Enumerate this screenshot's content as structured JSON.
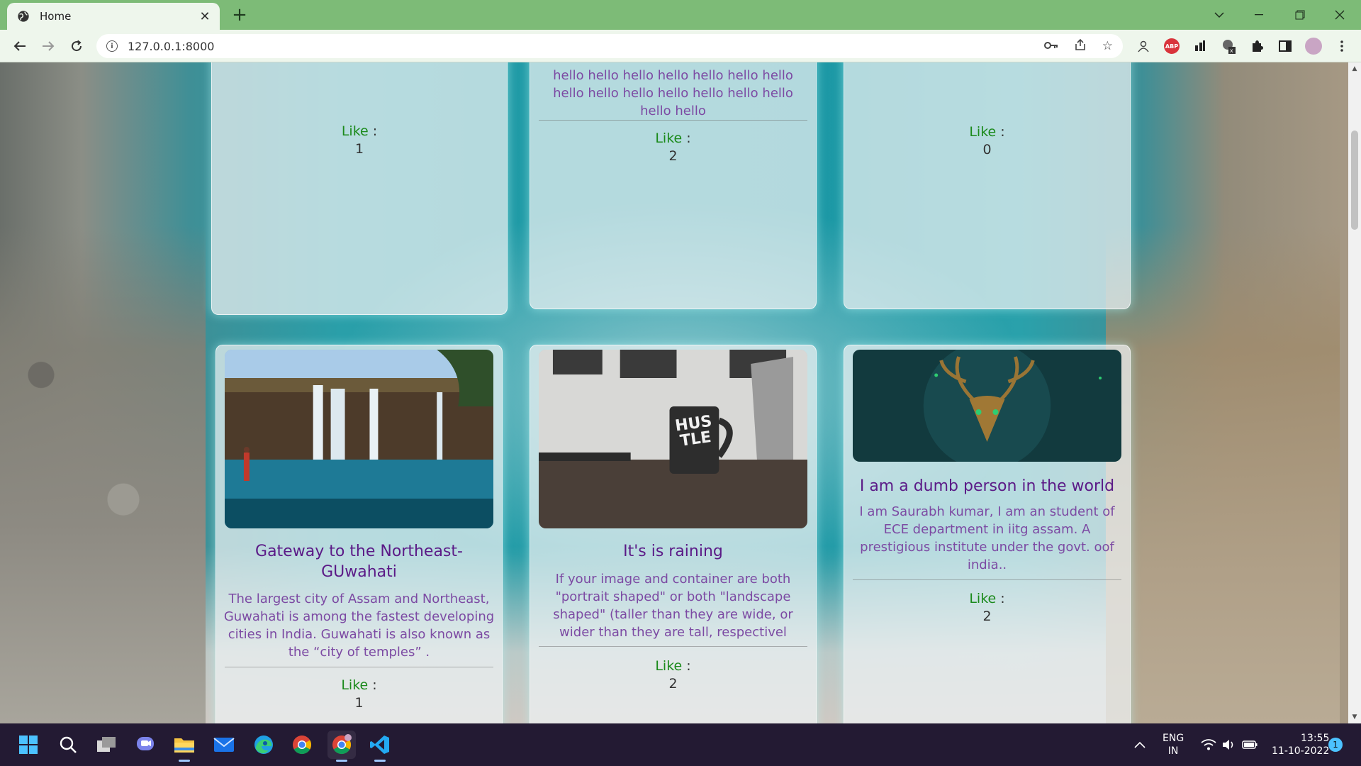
{
  "browser": {
    "tab_title": "Home",
    "url": "127.0.0.1:8000"
  },
  "cards_top": [
    {
      "like_label": "Like",
      "like_count": "1"
    },
    {
      "desc": "hello hello hello hello hello hello hello hello hello hello hello hello hello hello hello hello",
      "like_label": "Like",
      "like_count": "2"
    },
    {
      "like_label": "Like",
      "like_count": "0"
    }
  ],
  "cards_bottom": [
    {
      "title": "Gateway to the Northeast-GUwahati",
      "desc": "The largest city of Assam and Northeast, Guwahati is among the fastest developing cities in India. Guwahati is also known as the “city of temples” .",
      "like_label": "Like",
      "like_count": "1",
      "image": "waterfall-photo"
    },
    {
      "title": "It's is raining",
      "desc": "If your image and container are both \"portrait shaped\" or both \"landscape shaped\" (taller than they are wide, or wider than they are tall, respectivel",
      "like_label": "Like",
      "like_count": "2",
      "image": "mug-photo",
      "mug_text": "HUS TLE"
    },
    {
      "title": "I am a dumb person in the world",
      "desc": "I am Saurabh kumar, I am an student of ECE department in iitg assam. A prestigious institute under the govt. oof india..",
      "like_label": "Like",
      "like_count": "2",
      "image": "deer-photo"
    }
  ],
  "taskbar": {
    "lang_top": "ENG",
    "lang_bottom": "IN",
    "time": "13:55",
    "date": "11-10-2022",
    "notification_count": "1"
  },
  "colors": {
    "tabbar": "#7dbb77",
    "card_title": "#5b1a87",
    "card_desc": "#7c4aa3",
    "like_label": "#1b8a1b",
    "taskbar": "#231a33"
  }
}
